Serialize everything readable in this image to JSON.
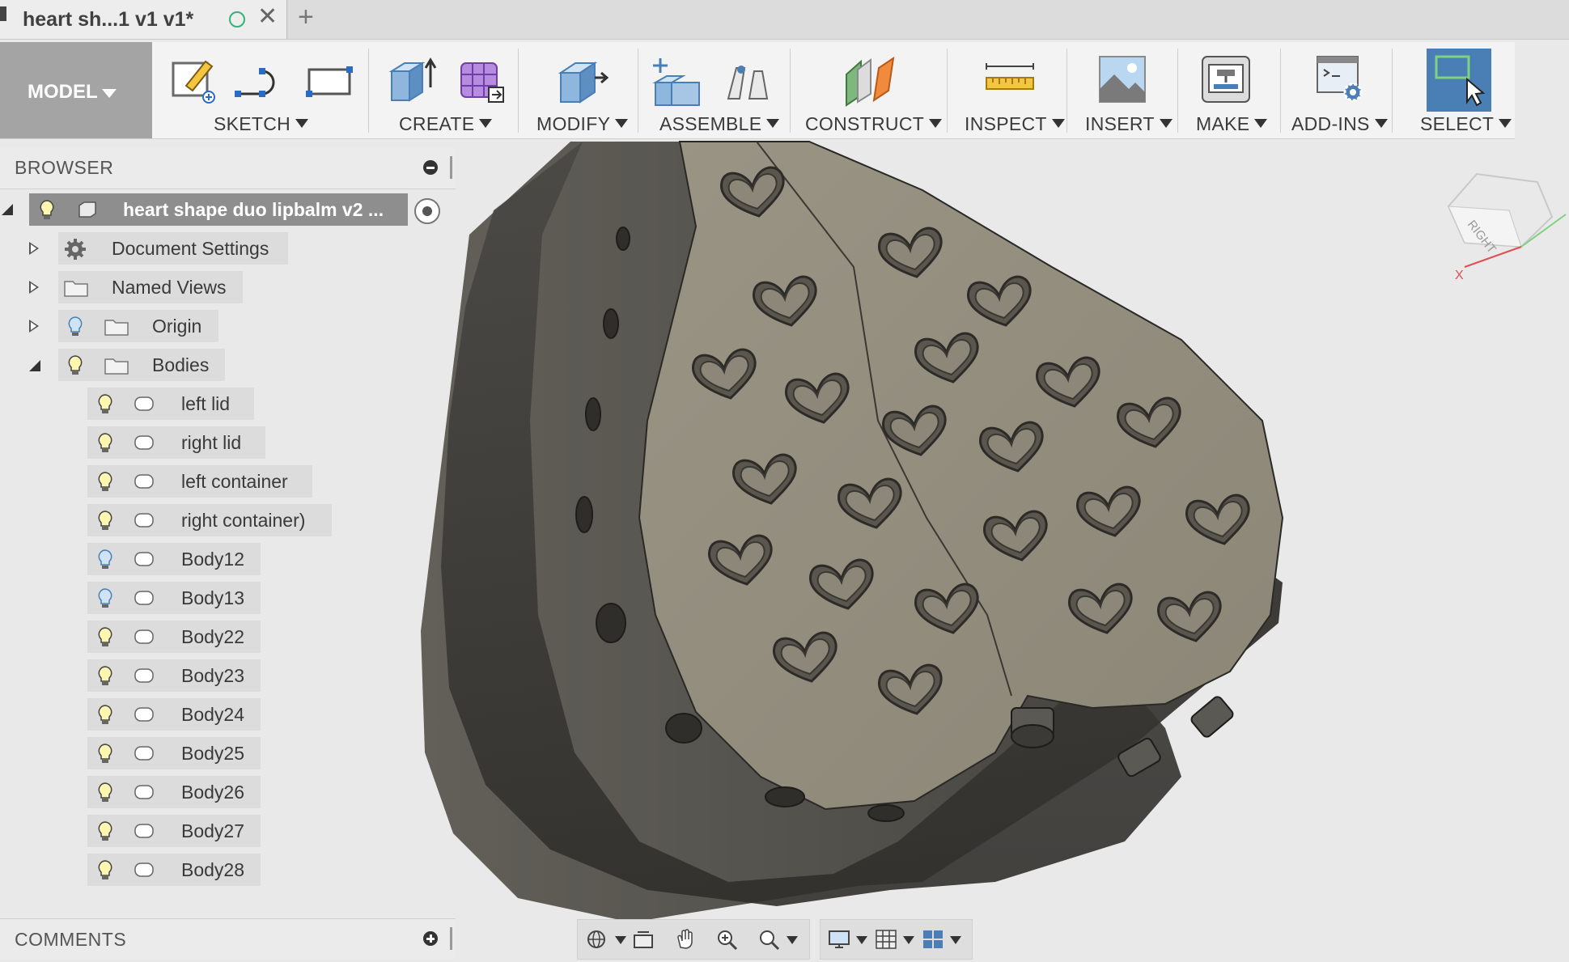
{
  "tab": {
    "title": "heart sh...1 v1 v1*",
    "close": "✕",
    "add": "+"
  },
  "toolbar": {
    "workspace": "MODEL",
    "groups": [
      "SKETCH",
      "CREATE",
      "MODIFY",
      "ASSEMBLE",
      "CONSTRUCT",
      "INSPECT",
      "INSERT",
      "MAKE",
      "ADD-INS",
      "SELECT"
    ]
  },
  "browser": {
    "title": "BROWSER",
    "root": "heart shape duo lipbalm v2 ...",
    "items": [
      {
        "label": "Document Settings",
        "icon": "gear-icon"
      },
      {
        "label": "Named Views",
        "icon": "folder-icon"
      },
      {
        "label": "Origin",
        "icon": "folder-icon"
      },
      {
        "label": "Bodies",
        "icon": "folder-icon"
      }
    ],
    "bodies": [
      "left lid",
      "right lid",
      "left container",
      "right container)",
      "Body12",
      "Body13",
      "Body22",
      "Body23",
      "Body24",
      "Body25",
      "Body26",
      "Body27",
      "Body28"
    ]
  },
  "comments": {
    "title": "COMMENTS"
  },
  "viewcube": {
    "face": "RIGHT",
    "axis_x": "X"
  },
  "colors": {
    "toolbar_bg": "#f3f3f3",
    "workspace_bg": "#a4a4a4",
    "select_accent": "#4a7fb5",
    "model_face": "#8d8779",
    "model_side": "#5f5c56"
  }
}
